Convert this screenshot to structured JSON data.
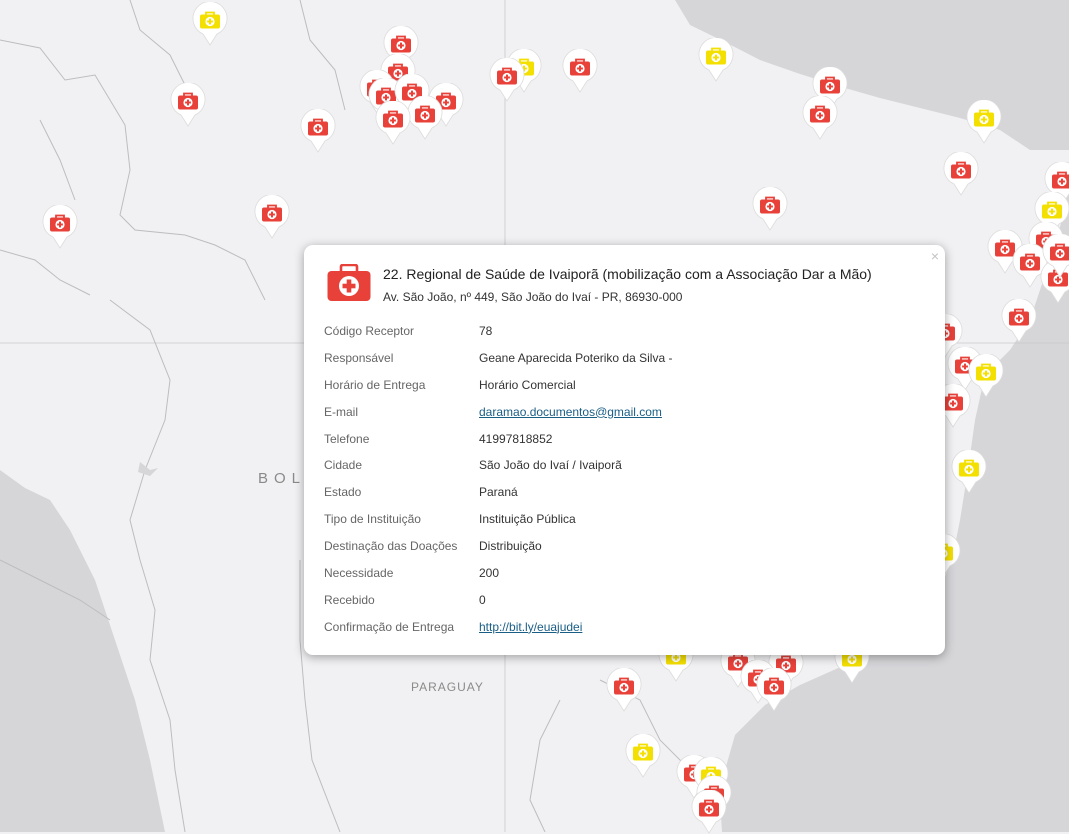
{
  "colors": {
    "map_background": "#f1f1f3",
    "water": "#d6d6d9",
    "border_line": "#bdbdbf",
    "marker_red": "#e8413a",
    "marker_yellow": "#f4e000",
    "link": "#1a5e86"
  },
  "map": {
    "country_labels": {
      "bolivia_partial": "BOL",
      "paraguay": "PARAGUAY"
    },
    "marker_icon": "first-aid-kit-icon"
  },
  "popup": {
    "close_symbol": "×",
    "icon": "first-aid-kit-icon",
    "title": "22. Regional de Saúde de Ivaiporã (mobilização com a Associação Dar a Mão)",
    "address": "Av. São João, nº 449, São João do Ivaí - PR, 86930-000",
    "fields": [
      {
        "label": "Código Receptor",
        "value": "78"
      },
      {
        "label": "Responsável",
        "value": "Geane Aparecida Poteriko da Silva -"
      },
      {
        "label": "Horário de Entrega",
        "value": "Horário Comercial"
      },
      {
        "label": "E-mail",
        "value": "daramao.documentos@gmail.com"
      },
      {
        "label": "Telefone",
        "value": "41997818852"
      },
      {
        "label": "Cidade",
        "value": "São João do Ivaí / Ivaiporã"
      },
      {
        "label": "Estado",
        "value": "Paraná"
      },
      {
        "label": "Tipo de Instituição",
        "value": "Instituição Pública"
      },
      {
        "label": "Destinação das Doações",
        "value": "Distribuição"
      },
      {
        "label": "Necessidade",
        "value": "200"
      },
      {
        "label": "Recebido",
        "value": "0"
      },
      {
        "label": "Confirmação de Entrega",
        "value": "http://bit.ly/euajudei"
      }
    ]
  }
}
